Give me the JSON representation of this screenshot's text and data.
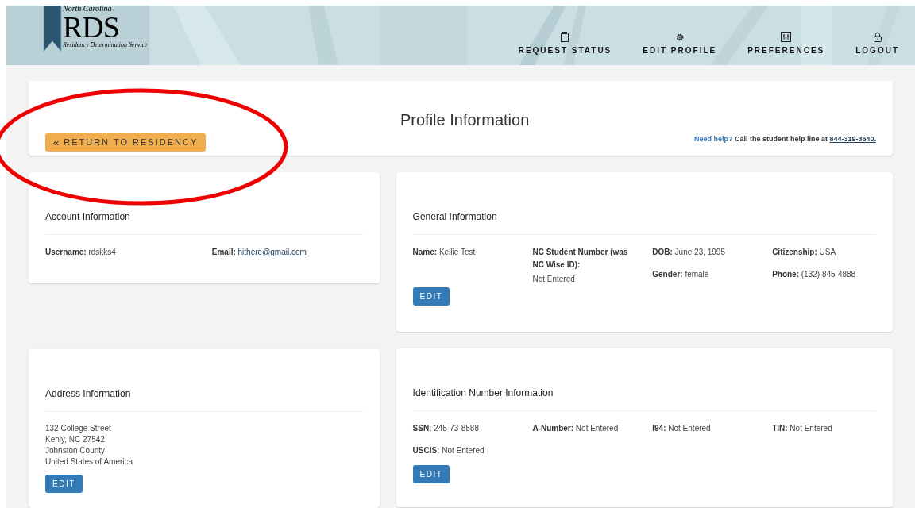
{
  "logo": {
    "region": "North Carolina",
    "name": "RDS",
    "tagline": "Residency Determination Service"
  },
  "nav": [
    {
      "label": "REQUEST STATUS",
      "kind": "clipboard"
    },
    {
      "label": "EDIT PROFILE",
      "kind": "gear"
    },
    {
      "label": "PREFERENCES",
      "kind": "sliders"
    },
    {
      "label": "LOGOUT",
      "kind": "lock"
    }
  ],
  "return_button": {
    "icon": "«",
    "label": "RETURN TO RESIDENCY"
  },
  "page_title": "Profile Information",
  "help": {
    "lead": "Need help?",
    "text": "Call the student help line at",
    "phone": "844-319-3640."
  },
  "account": {
    "title": "Account Information",
    "fields": [
      {
        "label": "Username:",
        "value": "rdskks4",
        "kind": "text"
      },
      {
        "label": "Email:",
        "value": "hithere@gmail.com",
        "kind": "link"
      }
    ]
  },
  "general": {
    "title": "General Information",
    "columns": [
      [
        {
          "label": "Name:",
          "value": "Kellie Test",
          "kind": "inline"
        }
      ],
      [
        {
          "label": "NC Student Number (was NC Wise ID):",
          "value": "Not Entered",
          "kind": "stacked"
        }
      ],
      [
        {
          "label": "DOB:",
          "value": "June 23, 1995",
          "kind": "inline"
        },
        {
          "label": "Gender:",
          "value": "female",
          "kind": "inline"
        }
      ],
      [
        {
          "label": "Citizenship:",
          "value": "USA",
          "kind": "inline"
        },
        {
          "label": "Phone:",
          "value": "(132) 845-4888",
          "kind": "inline"
        }
      ]
    ],
    "button": "EDIT"
  },
  "address": {
    "title": "Address Information",
    "lines": [
      "132 College Street",
      "Kenly, NC 27542",
      "Johnston County",
      "United States of America"
    ],
    "button": "EDIT"
  },
  "identification": {
    "title": "Identification Number Information",
    "fields": [
      {
        "label": "SSN:",
        "value": "245-73-8588"
      },
      {
        "label": "A-Number:",
        "value": "Not Entered"
      },
      {
        "label": "I94:",
        "value": "Not Entered"
      },
      {
        "label": "TIN:",
        "value": "Not Entered"
      },
      {
        "label": "USCIS:",
        "value": "Not Entered"
      }
    ],
    "button": "EDIT"
  },
  "annotations": [
    {
      "kind": "ellipse"
    }
  ]
}
